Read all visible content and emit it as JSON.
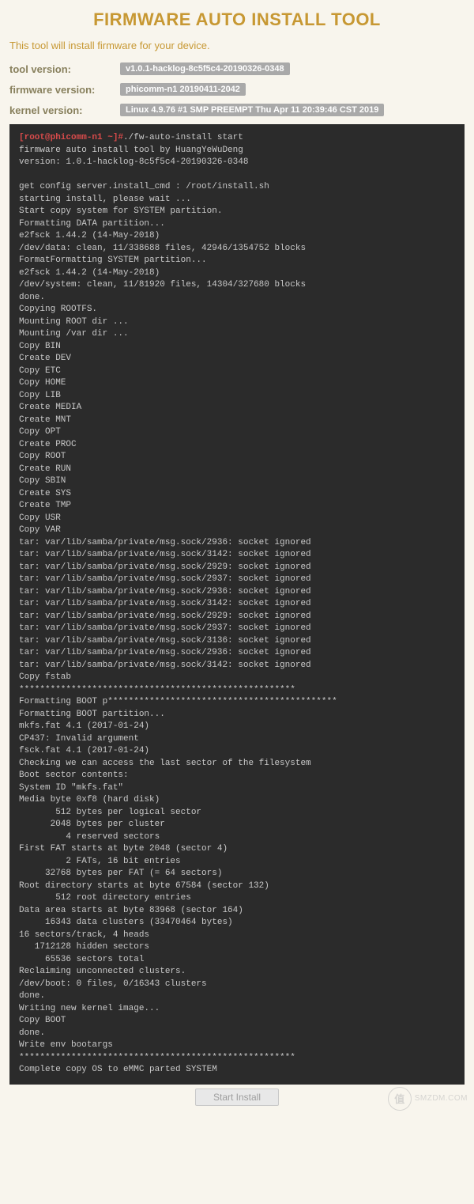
{
  "header": {
    "title": "FIRMWARE AUTO INSTALL TOOL",
    "subtitle": "This tool will install firmware for your device."
  },
  "info": {
    "tool_label": "tool version:",
    "tool_value": "v1.0.1-hacklog-8c5f5c4-20190326-0348",
    "firmware_label": "firmware version:",
    "firmware_value": "phicomm-n1 20190411-2042",
    "kernel_label": "kernel version:",
    "kernel_value": "Linux 4.9.76 #1 SMP PREEMPT Thu Apr 11 20:39:46 CST 2019"
  },
  "terminal": {
    "prompt": "[root@phicomm-n1 ~]#",
    "cmd": "./fw-auto-install start",
    "body": "firmware auto install tool by HuangYeWuDeng\nversion: 1.0.1-hacklog-8c5f5c4-20190326-0348\n\nget config server.install_cmd : /root/install.sh\nstarting install, please wait ...\nStart copy system for SYSTEM partition.\nFormatting DATA partition...\ne2fsck 1.44.2 (14-May-2018)\n/dev/data: clean, 11/338688 files, 42946/1354752 blocks\nFormatFormatting SYSTEM partition...\ne2fsck 1.44.2 (14-May-2018)\n/dev/system: clean, 11/81920 files, 14304/327680 blocks\ndone.\nCopying ROOTFS.\nMounting ROOT dir ...\nMounting /var dir ...\nCopy BIN\nCreate DEV\nCopy ETC\nCopy HOME\nCopy LIB\nCreate MEDIA\nCreate MNT\nCopy OPT\nCreate PROC\nCopy ROOT\nCreate RUN\nCopy SBIN\nCreate SYS\nCreate TMP\nCopy USR\nCopy VAR\ntar: var/lib/samba/private/msg.sock/2936: socket ignored\ntar: var/lib/samba/private/msg.sock/3142: socket ignored\ntar: var/lib/samba/private/msg.sock/2929: socket ignored\ntar: var/lib/samba/private/msg.sock/2937: socket ignored\ntar: var/lib/samba/private/msg.sock/2936: socket ignored\ntar: var/lib/samba/private/msg.sock/3142: socket ignored\ntar: var/lib/samba/private/msg.sock/2929: socket ignored\ntar: var/lib/samba/private/msg.sock/2937: socket ignored\ntar: var/lib/samba/private/msg.sock/3136: socket ignored\ntar: var/lib/samba/private/msg.sock/2936: socket ignored\ntar: var/lib/samba/private/msg.sock/3142: socket ignored\nCopy fstab\n*****************************************************\nFormatting BOOT p********************************************\nFormatting BOOT partition...\nmkfs.fat 4.1 (2017-01-24)\nCP437: Invalid argument\nfsck.fat 4.1 (2017-01-24)\nChecking we can access the last sector of the filesystem\nBoot sector contents:\nSystem ID \"mkfs.fat\"\nMedia byte 0xf8 (hard disk)\n       512 bytes per logical sector\n      2048 bytes per cluster\n         4 reserved sectors\nFirst FAT starts at byte 2048 (sector 4)\n         2 FATs, 16 bit entries\n     32768 bytes per FAT (= 64 sectors)\nRoot directory starts at byte 67584 (sector 132)\n       512 root directory entries\nData area starts at byte 83968 (sector 164)\n     16343 data clusters (33470464 bytes)\n16 sectors/track, 4 heads\n   1712128 hidden sectors\n     65536 sectors total\nReclaiming unconnected clusters.\n/dev/boot: 0 files, 0/16343 clusters\ndone.\nWriting new kernel image...\nCopy BOOT\ndone.\nWrite env bootargs\n*****************************************************\nComplete copy OS to eMMC parted SYSTEM"
  },
  "footer": {
    "start_button": "Start Install"
  },
  "watermark": {
    "icon": "值",
    "text": "SMZDM.COM"
  }
}
